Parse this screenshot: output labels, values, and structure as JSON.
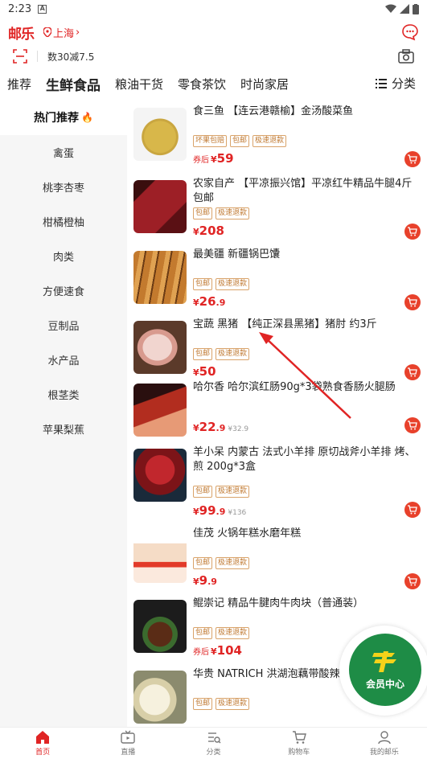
{
  "status": {
    "time": "2:23",
    "a_icon": "A"
  },
  "header": {
    "logo": "邮乐",
    "location": "上海"
  },
  "search": {
    "text": "数30减7.5"
  },
  "tabs": [
    "推荐",
    "生鲜食品",
    "粮油干货",
    "零食茶饮",
    "时尚家居"
  ],
  "tabs_more": "分类",
  "sidebar": [
    {
      "label": "热门推荐",
      "active": true
    },
    {
      "label": "禽蛋"
    },
    {
      "label": "桃李杏枣"
    },
    {
      "label": "柑橘橙柚"
    },
    {
      "label": "肉类"
    },
    {
      "label": "方便速食"
    },
    {
      "label": "豆制品"
    },
    {
      "label": "水产品"
    },
    {
      "label": "根茎类"
    },
    {
      "label": "苹果梨蕉"
    }
  ],
  "products": [
    {
      "title": "食三鱼 【连云港赣榆】金汤酸菜鱼",
      "tags": [
        "坏果包赔",
        "包邮",
        "极速退款"
      ],
      "price_prefix": "券后",
      "price_yen": "¥",
      "price_int": "59",
      "price_dec": "",
      "orig": ""
    },
    {
      "title": "农家自产 【平凉振兴馆】平凉红牛精品牛腿4斤包邮",
      "tags": [
        "包邮",
        "极速退款"
      ],
      "price_prefix": "",
      "price_yen": "¥",
      "price_int": "208",
      "price_dec": "",
      "orig": ""
    },
    {
      "title": "最美疆 新疆锅巴馕",
      "tags": [
        "包邮",
        "极速退款"
      ],
      "price_prefix": "",
      "price_yen": "¥",
      "price_int": "26",
      "price_dec": ".9",
      "orig": ""
    },
    {
      "title": "宝蔬 黑猪 【纯正深县黑猪】猪肘 约3斤",
      "tags": [
        "包邮",
        "极速退款"
      ],
      "price_prefix": "",
      "price_yen": "¥",
      "price_int": "50",
      "price_dec": "",
      "orig": ""
    },
    {
      "title": "哈尔香 哈尔滨红肠90g*3袋熟食香肠火腿肠",
      "tags": [],
      "price_prefix": "",
      "price_yen": "¥",
      "price_int": "22",
      "price_dec": ".9",
      "orig": "¥32.9"
    },
    {
      "title": "羊小呆 内蒙古 法式小羊排 原切战斧小羊排 烤、煎 200g*3盒",
      "tags": [
        "包邮",
        "极速退款"
      ],
      "price_prefix": "",
      "price_yen": "¥",
      "price_int": "99",
      "price_dec": ".9",
      "orig": "¥136"
    },
    {
      "title": "佳茂 火锅年糕水磨年糕",
      "tags": [
        "包邮",
        "极速退款"
      ],
      "price_prefix": "",
      "price_yen": "¥",
      "price_int": "9",
      "price_dec": ".9",
      "orig": ""
    },
    {
      "title": "鲲崇记 精品牛腱肉牛肉块（普通装）",
      "tags": [
        "包邮",
        "极速退款"
      ],
      "price_prefix": "券后",
      "price_yen": "¥",
      "price_int": "104",
      "price_dec": "",
      "orig": ""
    },
    {
      "title": "华贵 NATRICH 洪湖泡藕带酸辣脆 400g*3袋",
      "tags": [
        "包邮",
        "极速退款"
      ],
      "price_prefix": "",
      "price_yen": "",
      "price_int": "",
      "price_dec": "",
      "orig": ""
    }
  ],
  "member": {
    "label": "会员中心"
  },
  "bottom_nav": [
    {
      "label": "首页",
      "icon": "home-icon",
      "active": true
    },
    {
      "label": "直播",
      "icon": "live-icon"
    },
    {
      "label": "分类",
      "icon": "category-icon"
    },
    {
      "label": "购物车",
      "icon": "cart-icon"
    },
    {
      "label": "我的邮乐",
      "icon": "profile-icon"
    }
  ],
  "colors": {
    "brand": "#e02424",
    "member": "#1e8c46",
    "tag": "#c07a33"
  }
}
